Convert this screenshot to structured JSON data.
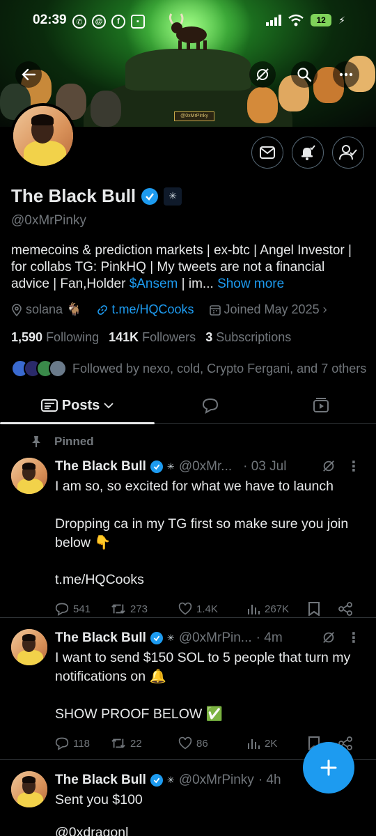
{
  "status_bar": {
    "time": "02:39",
    "battery": "12"
  },
  "banner": {
    "sign_text": "@0xMrPinky"
  },
  "profile": {
    "name": "The Black Bull",
    "handle": "@0xMrPinky",
    "bio_text": "memecoins & prediction markets | ex-btc | Angel Investor | for collabs TG: PinkHQ | My tweets are not a financial advice | Fan,Holder ",
    "bio_cashtag": "$Ansem",
    "bio_tail": " | im...",
    "show_more": "Show more",
    "location": "solana",
    "website": "t.me/HQCooks",
    "joined": "Joined May 2025",
    "following_count": "1,590",
    "following_label": "Following",
    "followers_count": "141K",
    "followers_label": "Followers",
    "subscriptions_count": "3",
    "subscriptions_label": "Subscriptions",
    "followed_by": "Followed by nexo, cold, Crypto Fergani, and 7 others"
  },
  "tabs": {
    "posts_label": "Posts"
  },
  "pinned_label": "Pinned",
  "posts": [
    {
      "name": "The Black Bull",
      "handle": "@0xMr...",
      "time": "· 03 Jul",
      "text": "I am so, so excited for what we have to launch\n\nDropping ca in my TG first so make sure you join below 👇",
      "link": "t.me/HQCooks",
      "replies": "541",
      "reposts": "273",
      "likes": "1.4K",
      "views": "267K"
    },
    {
      "name": "The Black Bull",
      "handle": "@0xMrPin...",
      "time": "· 4m",
      "text": "I want to send $150 SOL to 5 people that turn my notifications on 🔔\n\nSHOW PROOF BELOW ✅",
      "replies": "118",
      "reposts": "22",
      "likes": "86",
      "views": "2K"
    },
    {
      "name": "The Black Bull",
      "handle": "@0xMrPinky",
      "time": "· 4h",
      "text": "Sent you $100",
      "link": "@0xdragonl"
    }
  ]
}
